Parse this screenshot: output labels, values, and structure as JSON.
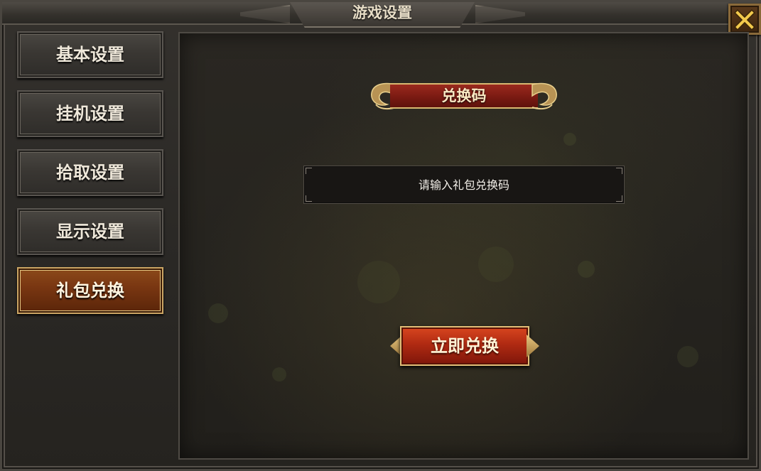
{
  "window": {
    "title": "游戏设置",
    "close_icon": "close-x-icon"
  },
  "sidebar": {
    "items": [
      {
        "label": "基本设置",
        "active": false
      },
      {
        "label": "挂机设置",
        "active": false
      },
      {
        "label": "拾取设置",
        "active": false
      },
      {
        "label": "显示设置",
        "active": false
      },
      {
        "label": "礼包兑换",
        "active": true
      }
    ]
  },
  "main": {
    "header": "兑换码",
    "code_input": {
      "value": "",
      "placeholder": "请输入礼包兑换码"
    },
    "redeem_button": "立即兑换"
  },
  "colors": {
    "accent_gold": "#d9b870",
    "button_red": "#b02a12",
    "active_tab": "#7a3712"
  }
}
